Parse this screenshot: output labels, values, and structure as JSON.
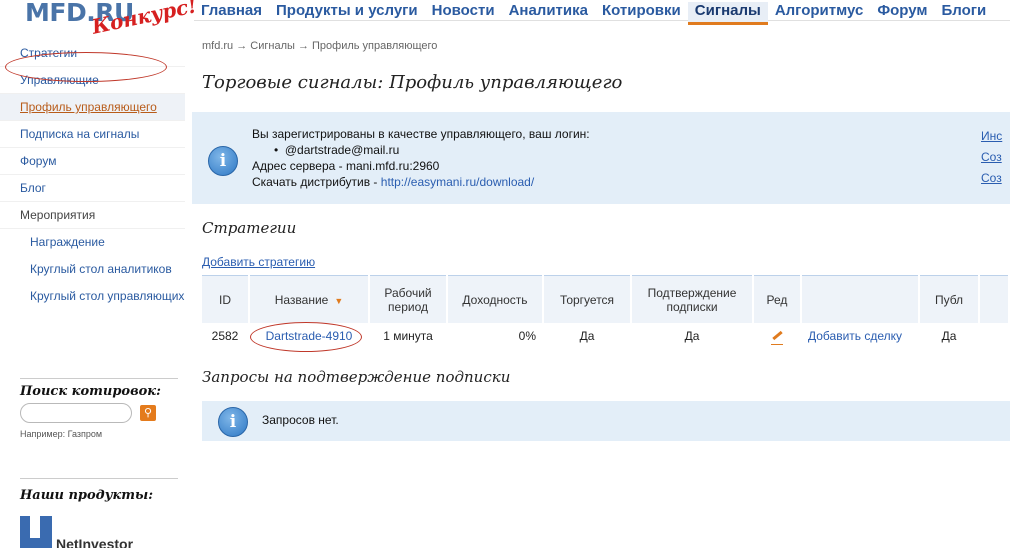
{
  "logo": {
    "brand": "MFD.RU",
    "contest": "Конкурс!"
  },
  "topnav": [
    "Главная",
    "Продукты и услуги",
    "Новости",
    "Аналитика",
    "Котировки",
    "Сигналы",
    "Алгоритмус",
    "Форум",
    "Блоги"
  ],
  "topnav_active": "Сигналы",
  "sidebar": {
    "items": [
      "Стратегии",
      "Управляющие",
      "Профиль управляющего",
      "Подписка на сигналы",
      "Форум",
      "Блог",
      "Мероприятия"
    ],
    "sub_items": [
      "Награждение",
      "Круглый стол аналитиков",
      "Круглый стол управляющих"
    ],
    "search_title": "Поиск котировок:",
    "search_placeholder": "",
    "search_hint": "Например: Газпром",
    "products_title": "Наши продукты:",
    "products_logo": "NetInvestor"
  },
  "breadcrumb": "mfd.ru → Сигналы → Профиль управляющего",
  "page_title": "Торговые сигналы: Профиль управляющего",
  "info": {
    "line1": "Вы зарегистрированы в качестве управляющего, ваш логин:",
    "login": "@dartstrade@mail.ru",
    "server": "Адрес сервера - mani.mfd.ru:2960",
    "download_prefix": "Скачать дистрибутив - ",
    "download_link": "http://easymani.ru/download/",
    "right_links": [
      "Инс",
      "Соз",
      "Соз"
    ]
  },
  "strategies": {
    "title": "Стратегии",
    "add_link": "Добавить стратегию",
    "columns": [
      "ID",
      "Название",
      "Рабочий период",
      "Доходность",
      "Торгуется",
      "Подтверждение подписки",
      "Ред",
      "",
      "Публ"
    ],
    "rows": [
      {
        "id": "2582",
        "name": "Dartstrade-4910",
        "period": "1 минута",
        "yield": "0%",
        "traded": "Да",
        "confirm": "Да",
        "action": "Добавить сделку",
        "pub": "Да"
      }
    ]
  },
  "requests": {
    "title": "Запросы на подтверждение подписки",
    "empty": "Запросов нет."
  },
  "colors": {
    "link": "#2a5aa0",
    "accent": "#e07b1e",
    "info_bg": "#e3eef8",
    "annotation": "#c0392b"
  }
}
